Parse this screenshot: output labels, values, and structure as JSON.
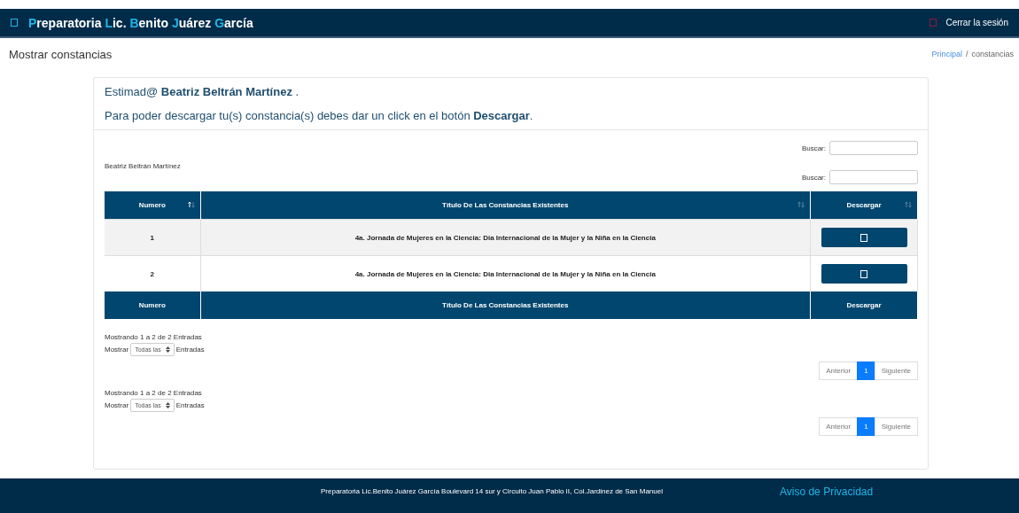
{
  "navbar": {
    "brand": [
      {
        "text": "P",
        "accent": true
      },
      {
        "text": "reparatoria ",
        "accent": false
      },
      {
        "text": "L",
        "accent": true
      },
      {
        "text": "ic. ",
        "accent": false
      },
      {
        "text": "B",
        "accent": true
      },
      {
        "text": "enito ",
        "accent": false
      },
      {
        "text": "J",
        "accent": true
      },
      {
        "text": "uárez ",
        "accent": false
      },
      {
        "text": "G",
        "accent": true
      },
      {
        "text": "arcía",
        "accent": false
      }
    ],
    "logout": "Cerrar la sesión"
  },
  "page_title": "Mostrar constancias",
  "breadcrumb": [
    {
      "label": "Principal",
      "link": true
    },
    {
      "label": "constancias",
      "link": false
    }
  ],
  "breadcrumb_separator": "/",
  "greeting": {
    "prefix": "Estimad@",
    "name": "Beatriz Beltrán Martínez",
    "suffix": "."
  },
  "instruction": "Para poder descargar tu(s) constancia(s) debes dar un click en el botón **Descargar**.",
  "search_label_top": "Buscar:",
  "student_name": "Beatriz Beltrán Martínez",
  "search_label": "Buscar:",
  "table": {
    "columns": [
      {
        "label": "Numero",
        "sorted": true
      },
      {
        "label": "Título De Las Constancias Existentes",
        "sorted": false
      },
      {
        "label": "Descargar",
        "sorted": false
      }
    ],
    "rows": [
      {
        "number": "1",
        "title": "4a. Jornada de Mujeres en la Ciencia: Dia Internacional de la Mujer y la Niña en la Ciencia"
      },
      {
        "number": "2",
        "title": "4a. Jornada de Mujeres en la Ciencia: Dia Internacional de la Mujer y la Niña en la Ciencia"
      }
    ],
    "footer": [
      "Numero",
      "Título De Las Constancias Existentes",
      "Descargar"
    ]
  },
  "info_blocks": [
    {
      "info": "Mostrando 1 a 2 de 2 Entradas",
      "show": "Mostrar",
      "select": "Todas las",
      "entries": "Entradas",
      "pages": [
        {
          "label": "Anterior",
          "selected": false
        },
        {
          "label": "1",
          "selected": true
        },
        {
          "label": "Siguiente",
          "selected": false
        }
      ]
    },
    {
      "info": "Mostrando 1 a 2 de 2 Entradas",
      "show": "Mostrar",
      "select": "Todas las",
      "entries": "Entradas",
      "pages": [
        {
          "label": "Anterior",
          "selected": false
        },
        {
          "label": "1",
          "selected": true
        },
        {
          "label": "Siguiente",
          "selected": false
        }
      ]
    }
  ],
  "footer": {
    "address": "Preparatoria Lic.Benito Juárez García Boulevard 14 sur y Circuito Juan Pablo II, Col.Jardinez de San Manuel",
    "privacy": "Aviso de Privacidad"
  }
}
